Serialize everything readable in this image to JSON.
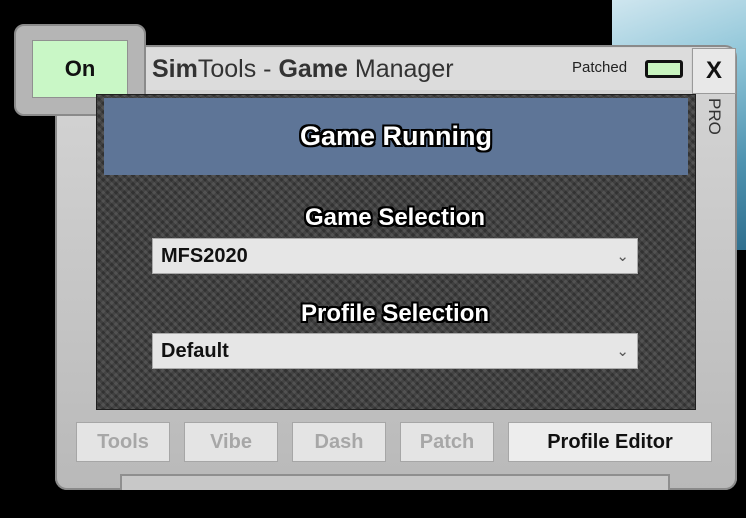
{
  "window": {
    "title_bold": "Sim",
    "title_mid": "Tools - ",
    "title_bold2": "Game",
    "title_end": " Manager",
    "patched_label": "Patched",
    "close_label": "X",
    "pro_label": "PRO",
    "on_label": "On"
  },
  "status": {
    "text": "Game Running"
  },
  "game_selection": {
    "label": "Game Selection",
    "value": "MFS2020"
  },
  "profile_selection": {
    "label": "Profile Selection",
    "value": "Default"
  },
  "toolbar": {
    "tools": "Tools",
    "vibe": "Vibe",
    "dash": "Dash",
    "patch": "Patch",
    "profile_editor": "Profile Editor"
  },
  "colors": {
    "on_button": "#c9f7c6",
    "status_banner": "#5e7597",
    "patched_led": "#c9f4c0"
  }
}
